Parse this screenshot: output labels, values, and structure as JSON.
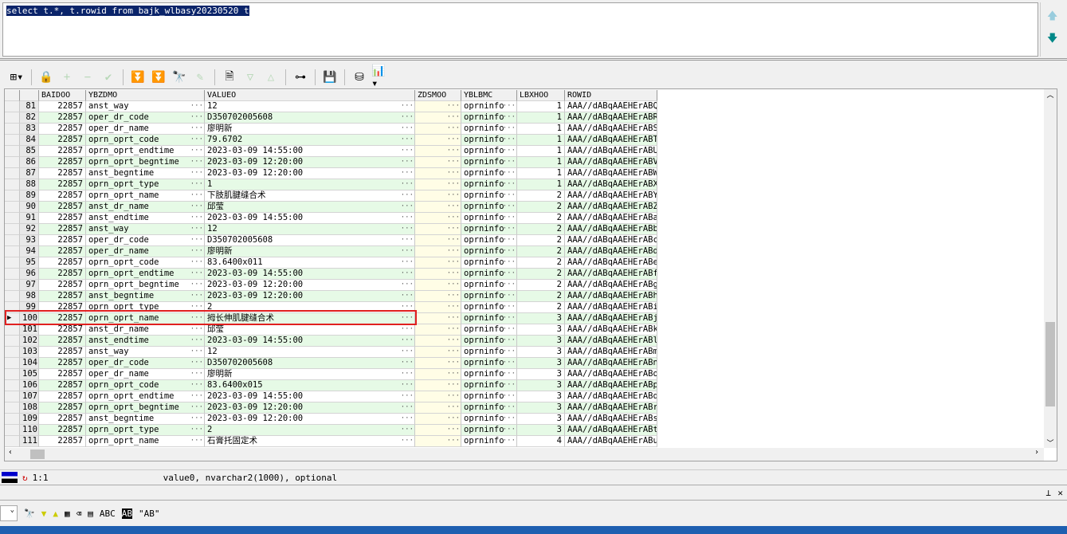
{
  "sql": "select t.*, t.rowid from bajk_wlbasy20230520 t",
  "columns": [
    "BAIDOO",
    "YBZDMO",
    "VALUEO",
    "ZDSMOO",
    "YBLBMC",
    "LBXHOO",
    "ROWID"
  ],
  "rows": [
    [
      "81",
      "22857",
      "anst_way",
      "12",
      "",
      "oprninfo",
      "1",
      "AAA//dABqAAEHErABQ"
    ],
    [
      "82",
      "22857",
      "oper_dr_code",
      "D350702005608",
      "",
      "oprninfo",
      "1",
      "AAA//dABqAAEHErABR"
    ],
    [
      "83",
      "22857",
      "oper_dr_name",
      "廖明新",
      "",
      "oprninfo",
      "1",
      "AAA//dABqAAEHErABS"
    ],
    [
      "84",
      "22857",
      "oprn_oprt_code",
      "79.6702",
      "",
      "oprninfo",
      "1",
      "AAA//dABqAAEHErABT"
    ],
    [
      "85",
      "22857",
      "oprn_oprt_endtime",
      "2023-03-09 14:55:00",
      "",
      "oprninfo",
      "1",
      "AAA//dABqAAEHErABU"
    ],
    [
      "86",
      "22857",
      "oprn_oprt_begntime",
      "2023-03-09 12:20:00",
      "",
      "oprninfo",
      "1",
      "AAA//dABqAAEHErABV"
    ],
    [
      "87",
      "22857",
      "anst_begntime",
      "2023-03-09 12:20:00",
      "",
      "oprninfo",
      "1",
      "AAA//dABqAAEHErABW"
    ],
    [
      "88",
      "22857",
      "oprn_oprt_type",
      "1",
      "",
      "oprninfo",
      "1",
      "AAA//dABqAAEHErABX"
    ],
    [
      "89",
      "22857",
      "oprn_oprt_name",
      "下肢肌腱缝合术",
      "",
      "oprninfo",
      "2",
      "AAA//dABqAAEHErABY"
    ],
    [
      "90",
      "22857",
      "anst_dr_name",
      "邱莹",
      "",
      "oprninfo",
      "2",
      "AAA//dABqAAEHErABZ"
    ],
    [
      "91",
      "22857",
      "anst_endtime",
      "2023-03-09 14:55:00",
      "",
      "oprninfo",
      "2",
      "AAA//dABqAAEHErABa"
    ],
    [
      "92",
      "22857",
      "anst_way",
      "12",
      "",
      "oprninfo",
      "2",
      "AAA//dABqAAEHErABb"
    ],
    [
      "93",
      "22857",
      "oper_dr_code",
      "D350702005608",
      "",
      "oprninfo",
      "2",
      "AAA//dABqAAEHErABc"
    ],
    [
      "94",
      "22857",
      "oper_dr_name",
      "廖明新",
      "",
      "oprninfo",
      "2",
      "AAA//dABqAAEHErABd"
    ],
    [
      "95",
      "22857",
      "oprn_oprt_code",
      "83.6400x011",
      "",
      "oprninfo",
      "2",
      "AAA//dABqAAEHErABe"
    ],
    [
      "96",
      "22857",
      "oprn_oprt_endtime",
      "2023-03-09 14:55:00",
      "",
      "oprninfo",
      "2",
      "AAA//dABqAAEHErABf"
    ],
    [
      "97",
      "22857",
      "oprn_oprt_begntime",
      "2023-03-09 12:20:00",
      "",
      "oprninfo",
      "2",
      "AAA//dABqAAEHErABg"
    ],
    [
      "98",
      "22857",
      "anst_begntime",
      "2023-03-09 12:20:00",
      "",
      "oprninfo",
      "2",
      "AAA//dABqAAEHErABh"
    ],
    [
      "99",
      "22857",
      "oprn_oprt_type",
      "2",
      "",
      "oprninfo",
      "2",
      "AAA//dABqAAEHErABi"
    ],
    [
      "100",
      "22857",
      "oprn_oprt_name",
      "拇长伸肌腱缝合术",
      "",
      "oprninfo",
      "3",
      "AAA//dABqAAEHErABj"
    ],
    [
      "101",
      "22857",
      "anst_dr_name",
      "邱莹",
      "",
      "oprninfo",
      "3",
      "AAA//dABqAAEHErABk"
    ],
    [
      "102",
      "22857",
      "anst_endtime",
      "2023-03-09 14:55:00",
      "",
      "oprninfo",
      "3",
      "AAA//dABqAAEHErABl"
    ],
    [
      "103",
      "22857",
      "anst_way",
      "12",
      "",
      "oprninfo",
      "3",
      "AAA//dABqAAEHErABm"
    ],
    [
      "104",
      "22857",
      "oper_dr_code",
      "D350702005608",
      "",
      "oprninfo",
      "3",
      "AAA//dABqAAEHErABn"
    ],
    [
      "105",
      "22857",
      "oper_dr_name",
      "廖明新",
      "",
      "oprninfo",
      "3",
      "AAA//dABqAAEHErABo"
    ],
    [
      "106",
      "22857",
      "oprn_oprt_code",
      "83.6400x015",
      "",
      "oprninfo",
      "3",
      "AAA//dABqAAEHErABp"
    ],
    [
      "107",
      "22857",
      "oprn_oprt_endtime",
      "2023-03-09 14:55:00",
      "",
      "oprninfo",
      "3",
      "AAA//dABqAAEHErABq"
    ],
    [
      "108",
      "22857",
      "oprn_oprt_begntime",
      "2023-03-09 12:20:00",
      "",
      "oprninfo",
      "3",
      "AAA//dABqAAEHErABr"
    ],
    [
      "109",
      "22857",
      "anst_begntime",
      "2023-03-09 12:20:00",
      "",
      "oprninfo",
      "3",
      "AAA//dABqAAEHErABs"
    ],
    [
      "110",
      "22857",
      "oprn_oprt_type",
      "2",
      "",
      "oprninfo",
      "3",
      "AAA//dABqAAEHErABt"
    ],
    [
      "111",
      "22857",
      "oprn_oprt_name",
      "石膏托固定术",
      "",
      "oprninfo",
      "4",
      "AAA//dABqAAEHErABu"
    ]
  ],
  "current_row": "100",
  "status": {
    "position": "1:1",
    "field_info": "value0, nvarchar2(1000), optional"
  },
  "bottom_toolbar": {
    "abc": "ABC",
    "abc_inverted": "AB",
    "quoted": "\"AB\""
  }
}
